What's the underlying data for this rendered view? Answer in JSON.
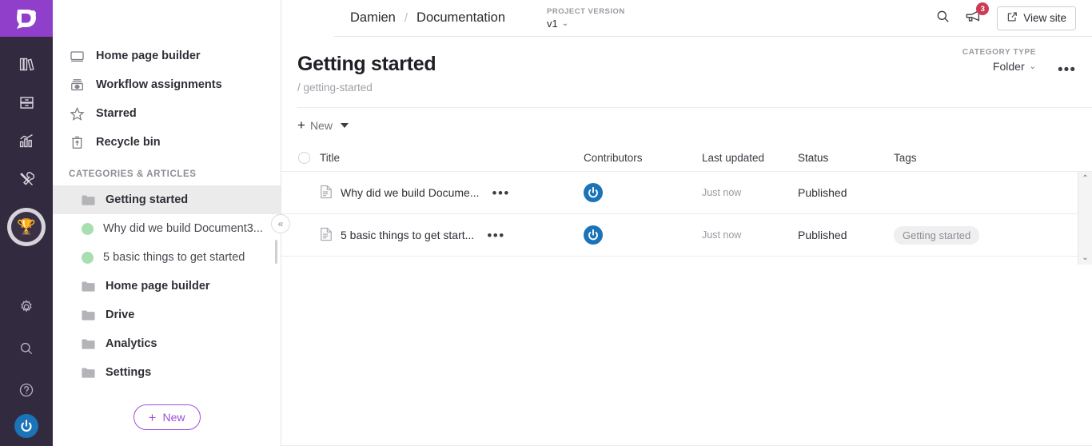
{
  "brand": {
    "logo_name": "document360-logo",
    "logo_color": "#8f3fc9"
  },
  "rail": {
    "items": [
      {
        "name": "knowledge-base",
        "icon": "books-icon"
      },
      {
        "name": "drive",
        "icon": "archive-drawer-icon"
      },
      {
        "name": "analytics",
        "icon": "analytics-chart-icon"
      },
      {
        "name": "tools",
        "icon": "tools-icon"
      }
    ],
    "trophy": {
      "icon": "trophy-icon",
      "glyph": "🏆"
    },
    "bottom": [
      {
        "name": "settings",
        "icon": "gear-icon"
      },
      {
        "name": "search",
        "icon": "search-icon"
      },
      {
        "name": "help",
        "icon": "help-circle-icon"
      }
    ],
    "avatar_name": "user-avatar"
  },
  "header": {
    "breadcrumb": [
      "Damien",
      "Documentation"
    ],
    "separator": "/",
    "project_version_label": "PROJECT VERSION",
    "project_version_value": "v1",
    "search_icon": "search-icon",
    "announcement_icon": "megaphone-icon",
    "announcement_count": "3",
    "view_site_label": "View site",
    "view_site_icon": "external-link-icon"
  },
  "sidebar": {
    "nav": [
      {
        "label": "Home page builder",
        "icon": "monitor-icon"
      },
      {
        "label": "Workflow assignments",
        "icon": "inbox-icon"
      },
      {
        "label": "Starred",
        "icon": "star-icon"
      },
      {
        "label": "Recycle bin",
        "icon": "trash-icon"
      }
    ],
    "section_label": "CATEGORIES & ARTICLES",
    "tree": [
      {
        "label": "Getting started",
        "type": "folder",
        "selected": true
      },
      {
        "label": "Why did we build Document3...",
        "type": "article",
        "selected": false
      },
      {
        "label": "5 basic things to get started",
        "type": "article",
        "selected": false
      },
      {
        "label": "Home page builder",
        "type": "folder",
        "selected": false
      },
      {
        "label": "Drive",
        "type": "folder",
        "selected": false
      },
      {
        "label": "Analytics",
        "type": "folder",
        "selected": false
      },
      {
        "label": "Settings",
        "type": "folder",
        "selected": false
      }
    ],
    "new_button_label": "New",
    "new_button_plus": "+",
    "collapse_icon": "chevron-double-left-icon"
  },
  "page": {
    "title": "Getting started",
    "slug": "/ getting-started",
    "category_type_label": "CATEGORY TYPE",
    "category_type_value": "Folder",
    "overflow_menu": "•••",
    "new_label": "New",
    "new_plus": "+"
  },
  "table": {
    "columns": {
      "title": "Title",
      "contributors": "Contributors",
      "last_updated": "Last updated",
      "status": "Status",
      "tags": "Tags"
    },
    "rows": [
      {
        "title": "Why did we build Docume...",
        "icon": "document-icon",
        "row_menu": "•••",
        "contributor": "contributor-avatar",
        "last_updated": "Just now",
        "status": "Published",
        "tag": ""
      },
      {
        "title": "5 basic things to get start...",
        "icon": "document-icon",
        "row_menu": "•••",
        "contributor": "contributor-avatar",
        "last_updated": "Just now",
        "status": "Published",
        "tag": "Getting started"
      }
    ],
    "scroll_up": "⌃",
    "scroll_down": "⌄"
  }
}
